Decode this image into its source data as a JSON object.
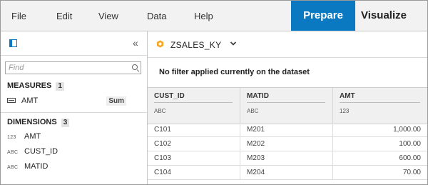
{
  "menu": {
    "items": [
      "File",
      "Edit",
      "View",
      "Data",
      "Help"
    ],
    "modes": {
      "prepare": "Prepare",
      "visualize": "Visualize"
    }
  },
  "left_panel": {
    "search_placeholder": "Find",
    "measures": {
      "title": "MEASURES",
      "count": "1",
      "items": [
        {
          "name": "AMT",
          "aggregation": "Sum"
        }
      ]
    },
    "dimensions": {
      "title": "DIMENSIONS",
      "count": "3",
      "items": [
        {
          "type": "123",
          "name": "AMT"
        },
        {
          "type": "ABC",
          "name": "CUST_ID"
        },
        {
          "type": "ABC",
          "name": "MATID"
        }
      ]
    }
  },
  "dataset": {
    "name": "ZSALES_KY",
    "filter_message": "No filter applied currently on the dataset"
  },
  "grid": {
    "columns": [
      {
        "name": "CUST_ID",
        "type": "ABC"
      },
      {
        "name": "MATID",
        "type": "ABC"
      },
      {
        "name": "AMT",
        "type": "123"
      }
    ],
    "rows": [
      [
        "C101",
        "M201",
        "1,000.00"
      ],
      [
        "C102",
        "M202",
        "100.00"
      ],
      [
        "C103",
        "M203",
        "600.00"
      ],
      [
        "C104",
        "M204",
        "70.00"
      ]
    ]
  },
  "colors": {
    "accent": "#0a79c2",
    "dataset_icon": "#f5a623"
  }
}
